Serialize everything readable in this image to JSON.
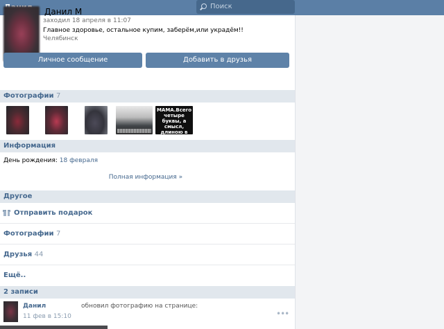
{
  "header": {
    "title": "Данил"
  },
  "search": {
    "placeholder": "Поиск"
  },
  "profile": {
    "name": "Данил М",
    "last_seen": "заходил 18 апреля в 11:07",
    "status": "Главное здоровье, остальное купим, заберём,или украдём!!",
    "city": "Челябинск"
  },
  "buttons": {
    "message": "Личное сообщение",
    "add_friend": "Добавить в друзья"
  },
  "photos": {
    "title": "Фотографии",
    "count": "7",
    "thumb5_text": "МАМА.Всего четыре буквы, а смысл, длиною в"
  },
  "info": {
    "title": "Информация",
    "birthday_label": "День рождения:",
    "birthday_value": "18 февраля",
    "full_info_link": "Полная информация »"
  },
  "other": {
    "title": "Другое",
    "send_gift": "Отправить подарок",
    "photos_label": "Фотографии",
    "photos_count": "7",
    "friends_label": "Друзья",
    "friends_count": "44",
    "more": "Ещё.."
  },
  "posts": {
    "title": "2 записи",
    "author": "Данил",
    "action": "обновил фотографию на странице:",
    "date": "11 фев в 15:10"
  }
}
